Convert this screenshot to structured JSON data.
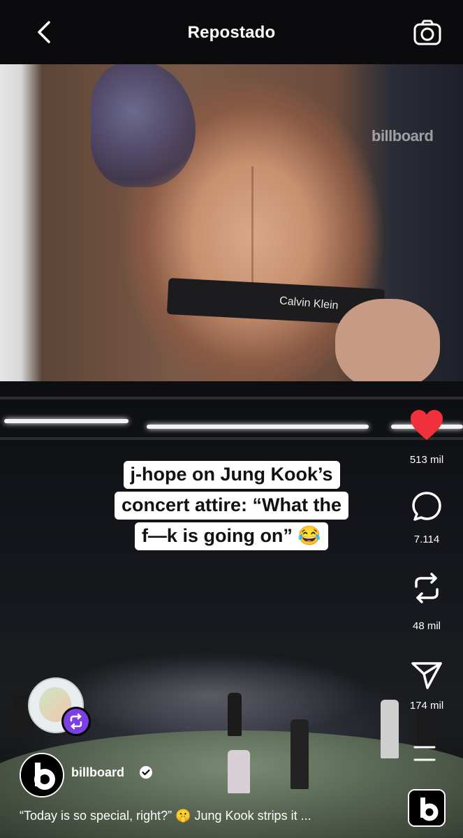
{
  "header": {
    "title": "Repostado",
    "back_icon": "chevron-left-icon",
    "camera_icon": "camera-icon"
  },
  "photo": {
    "watermark": "billboard",
    "waistband_text": "Calvin Klein"
  },
  "video": {
    "overlay_lines": [
      "j-hope on Jung Kook’s",
      "concert attire: “What the",
      "f—k is going on” 😂"
    ]
  },
  "actions": {
    "likes": "513 mil",
    "comments": "7.114",
    "reposts": "48 mil",
    "shares": "174 mil",
    "like_color": "#f0303a"
  },
  "account": {
    "name": "billboard",
    "avatar_letter": "b",
    "verified": true
  },
  "caption": "“Today is so special, right?” 🤫 Jung Kook strips it ...",
  "colors": {
    "accent": "#7b3fe4",
    "header_bg": "#0b0b0d"
  }
}
